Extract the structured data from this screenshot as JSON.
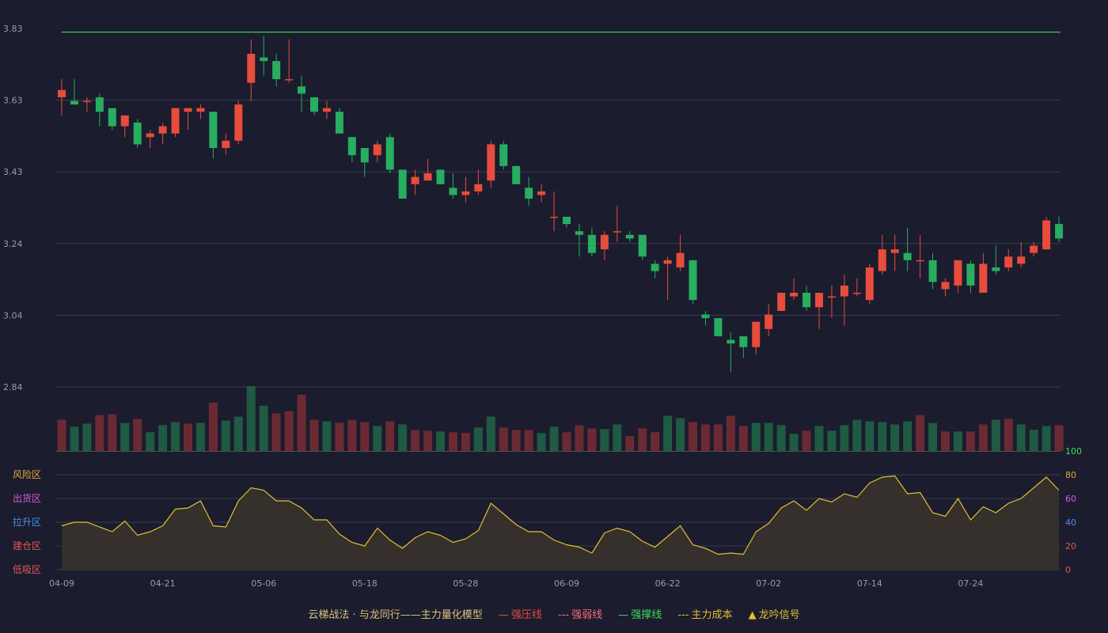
{
  "colors": {
    "background": "#1b1c2e",
    "up": "#e74c3c",
    "down": "#27ae60",
    "grid": "#3a3b4e",
    "top_line": "#3ddc5a",
    "indicator_line": "#e0c030",
    "indicator_fill": "#3a342a"
  },
  "chart_data": [
    {
      "type": "candlestick",
      "y_ticks": [
        "3.83",
        "3.63",
        "3.43",
        "3.24",
        "3.04",
        "2.84"
      ],
      "ylim": [
        2.84,
        3.83
      ],
      "x_tick_labels": [
        "04-09",
        "04-21",
        "05-06",
        "05-18",
        "05-28",
        "06-09",
        "06-22",
        "07-02",
        "07-14",
        "07-24"
      ],
      "x_tick_index": [
        0,
        8,
        16,
        24,
        32,
        40,
        48,
        56,
        64,
        72
      ],
      "horizontal_line": 3.82,
      "candles": [
        [
          3.64,
          3.66,
          3.59,
          3.69
        ],
        [
          3.63,
          3.62,
          3.62,
          3.69
        ],
        [
          3.63,
          3.63,
          3.6,
          3.64
        ],
        [
          3.64,
          3.6,
          3.56,
          3.65
        ],
        [
          3.61,
          3.56,
          3.55,
          3.61
        ],
        [
          3.56,
          3.59,
          3.53,
          3.59
        ],
        [
          3.57,
          3.51,
          3.5,
          3.58
        ],
        [
          3.53,
          3.54,
          3.5,
          3.55
        ],
        [
          3.54,
          3.56,
          3.51,
          3.57
        ],
        [
          3.54,
          3.61,
          3.53,
          3.61
        ],
        [
          3.6,
          3.61,
          3.55,
          3.61
        ],
        [
          3.6,
          3.61,
          3.58,
          3.62
        ],
        [
          3.6,
          3.5,
          3.47,
          3.6
        ],
        [
          3.5,
          3.52,
          3.48,
          3.54
        ],
        [
          3.52,
          3.62,
          3.51,
          3.63
        ],
        [
          3.68,
          3.76,
          3.63,
          3.8
        ],
        [
          3.75,
          3.74,
          3.7,
          3.81
        ],
        [
          3.74,
          3.69,
          3.67,
          3.76
        ],
        [
          3.69,
          3.69,
          3.68,
          3.8
        ],
        [
          3.67,
          3.65,
          3.6,
          3.7
        ],
        [
          3.64,
          3.6,
          3.59,
          3.64
        ],
        [
          3.6,
          3.61,
          3.58,
          3.63
        ],
        [
          3.6,
          3.54,
          3.54,
          3.61
        ],
        [
          3.53,
          3.48,
          3.46,
          3.53
        ],
        [
          3.5,
          3.46,
          3.42,
          3.5
        ],
        [
          3.48,
          3.51,
          3.46,
          3.52
        ],
        [
          3.53,
          3.44,
          3.43,
          3.54
        ],
        [
          3.44,
          3.36,
          3.36,
          3.44
        ],
        [
          3.4,
          3.42,
          3.37,
          3.44
        ],
        [
          3.41,
          3.43,
          3.41,
          3.47
        ],
        [
          3.44,
          3.4,
          3.4,
          3.44
        ],
        [
          3.39,
          3.37,
          3.36,
          3.43
        ],
        [
          3.37,
          3.38,
          3.35,
          3.42
        ],
        [
          3.38,
          3.4,
          3.37,
          3.44
        ],
        [
          3.41,
          3.51,
          3.39,
          3.52
        ],
        [
          3.51,
          3.45,
          3.44,
          3.52
        ],
        [
          3.45,
          3.4,
          3.4,
          3.45
        ],
        [
          3.39,
          3.36,
          3.34,
          3.42
        ],
        [
          3.37,
          3.38,
          3.35,
          3.4
        ],
        [
          3.31,
          3.31,
          3.27,
          3.38
        ],
        [
          3.31,
          3.29,
          3.28,
          3.31
        ],
        [
          3.27,
          3.26,
          3.2,
          3.29
        ],
        [
          3.26,
          3.21,
          3.2,
          3.28
        ],
        [
          3.22,
          3.26,
          3.19,
          3.27
        ],
        [
          3.27,
          3.27,
          3.24,
          3.34
        ],
        [
          3.26,
          3.25,
          3.24,
          3.27
        ],
        [
          3.26,
          3.2,
          3.19,
          3.26
        ],
        [
          3.18,
          3.16,
          3.14,
          3.19
        ],
        [
          3.18,
          3.19,
          3.08,
          3.2
        ],
        [
          3.17,
          3.21,
          3.16,
          3.26
        ],
        [
          3.19,
          3.08,
          3.07,
          3.19
        ],
        [
          3.04,
          3.03,
          3.01,
          3.05
        ],
        [
          3.03,
          2.98,
          3.0,
          3.01
        ],
        [
          2.97,
          2.96,
          2.88,
          2.99
        ],
        [
          2.98,
          2.95,
          2.92,
          2.98
        ],
        [
          2.95,
          3.02,
          2.93,
          3.02
        ],
        [
          3.0,
          3.04,
          2.98,
          3.07
        ],
        [
          3.05,
          3.1,
          3.05,
          3.1
        ],
        [
          3.09,
          3.1,
          3.08,
          3.14
        ],
        [
          3.1,
          3.06,
          3.05,
          3.12
        ],
        [
          3.06,
          3.1,
          3.0,
          3.1
        ],
        [
          3.09,
          3.09,
          3.03,
          3.12
        ],
        [
          3.09,
          3.12,
          3.01,
          3.15
        ],
        [
          3.1,
          3.1,
          3.09,
          3.14
        ],
        [
          3.08,
          3.17,
          3.07,
          3.18
        ],
        [
          3.16,
          3.22,
          3.15,
          3.26
        ],
        [
          3.21,
          3.22,
          3.16,
          3.26
        ],
        [
          3.21,
          3.19,
          3.16,
          3.28
        ],
        [
          3.19,
          3.19,
          3.14,
          3.26
        ],
        [
          3.19,
          3.13,
          3.11,
          3.21
        ],
        [
          3.11,
          3.13,
          3.09,
          3.14
        ],
        [
          3.12,
          3.19,
          3.1,
          3.19
        ],
        [
          3.18,
          3.12,
          3.1,
          3.19
        ],
        [
          3.1,
          3.18,
          3.1,
          3.21
        ],
        [
          3.17,
          3.16,
          3.15,
          3.23
        ],
        [
          3.17,
          3.2,
          3.16,
          3.22
        ],
        [
          3.18,
          3.2,
          3.17,
          3.24
        ],
        [
          3.21,
          3.23,
          3.2,
          3.24
        ],
        [
          3.22,
          3.3,
          3.22,
          3.31
        ],
        [
          3.29,
          3.25,
          3.24,
          3.31
        ]
      ],
      "volume": [
        40,
        31,
        35,
        46,
        47,
        36,
        41,
        24,
        33,
        37,
        35,
        36,
        62,
        39,
        44,
        83,
        58,
        48,
        51,
        72,
        40,
        38,
        36,
        40,
        37,
        32,
        38,
        34,
        27,
        26,
        25,
        24,
        23,
        30,
        44,
        30,
        27,
        27,
        23,
        31,
        24,
        33,
        29,
        28,
        34,
        19,
        29,
        24,
        45,
        42,
        37,
        34,
        34,
        45,
        32,
        36,
        36,
        33,
        22,
        26,
        32,
        26,
        33,
        40,
        38,
        37,
        34,
        38,
        46,
        36,
        25,
        25,
        25,
        34,
        40,
        41,
        34,
        27,
        32,
        33
      ],
      "volume_colors": [
        "up",
        "down",
        "down",
        "up",
        "up",
        "down",
        "up",
        "down",
        "down",
        "down",
        "up",
        "down",
        "up",
        "down",
        "down",
        "down",
        "down",
        "up",
        "up",
        "up",
        "up",
        "down",
        "up",
        "up",
        "up",
        "down",
        "up",
        "down",
        "up",
        "up",
        "down",
        "up",
        "up",
        "down",
        "down",
        "up",
        "up",
        "up",
        "down",
        "down",
        "up",
        "up",
        "up",
        "down",
        "down",
        "up",
        "up",
        "up",
        "down",
        "down",
        "up",
        "up",
        "up",
        "up",
        "up",
        "down",
        "down",
        "down",
        "down",
        "up",
        "down",
        "down",
        "down",
        "down",
        "down",
        "down",
        "down",
        "down",
        "up",
        "down",
        "up",
        "down",
        "up",
        "up",
        "down",
        "up",
        "down",
        "down",
        "down",
        "up"
      ]
    },
    {
      "type": "area",
      "ylim": [
        0,
        100
      ],
      "right_ticks": [
        "100",
        "80",
        "60",
        "40",
        "20",
        "0"
      ],
      "zone_labels": [
        "风险区",
        "出货区",
        "拉升区",
        "建仓区",
        "低吸区"
      ],
      "values": [
        37,
        40,
        40,
        36,
        32,
        41,
        29,
        32,
        37,
        51,
        52,
        58,
        37,
        36,
        58,
        69,
        67,
        58,
        58,
        52,
        42,
        42,
        30,
        23,
        20,
        35,
        25,
        18,
        27,
        32,
        29,
        23,
        26,
        33,
        56,
        47,
        38,
        32,
        32,
        25,
        21,
        19,
        14,
        31,
        35,
        32,
        24,
        19,
        28,
        37,
        21,
        18,
        13,
        14,
        13,
        32,
        39,
        52,
        58,
        50,
        60,
        57,
        64,
        61,
        73,
        78,
        79,
        64,
        65,
        48,
        45,
        60,
        42,
        53,
        48,
        56,
        60,
        69,
        78,
        67
      ]
    }
  ],
  "legend": {
    "title": "云梯战法 · 与龙同行——主力量化模型",
    "items": [
      {
        "label": "强压线",
        "marker": "—",
        "color": "#e74c3c"
      },
      {
        "label": "强弱线",
        "marker": "---",
        "color": "#ff6b7a"
      },
      {
        "label": "强撑线",
        "marker": "—",
        "color": "#3ddc5a"
      },
      {
        "label": "主力成本",
        "marker": "---",
        "color": "#e0c030"
      },
      {
        "label": "龙吟信号",
        "marker": "▲",
        "color": "#e0c030"
      }
    ]
  }
}
